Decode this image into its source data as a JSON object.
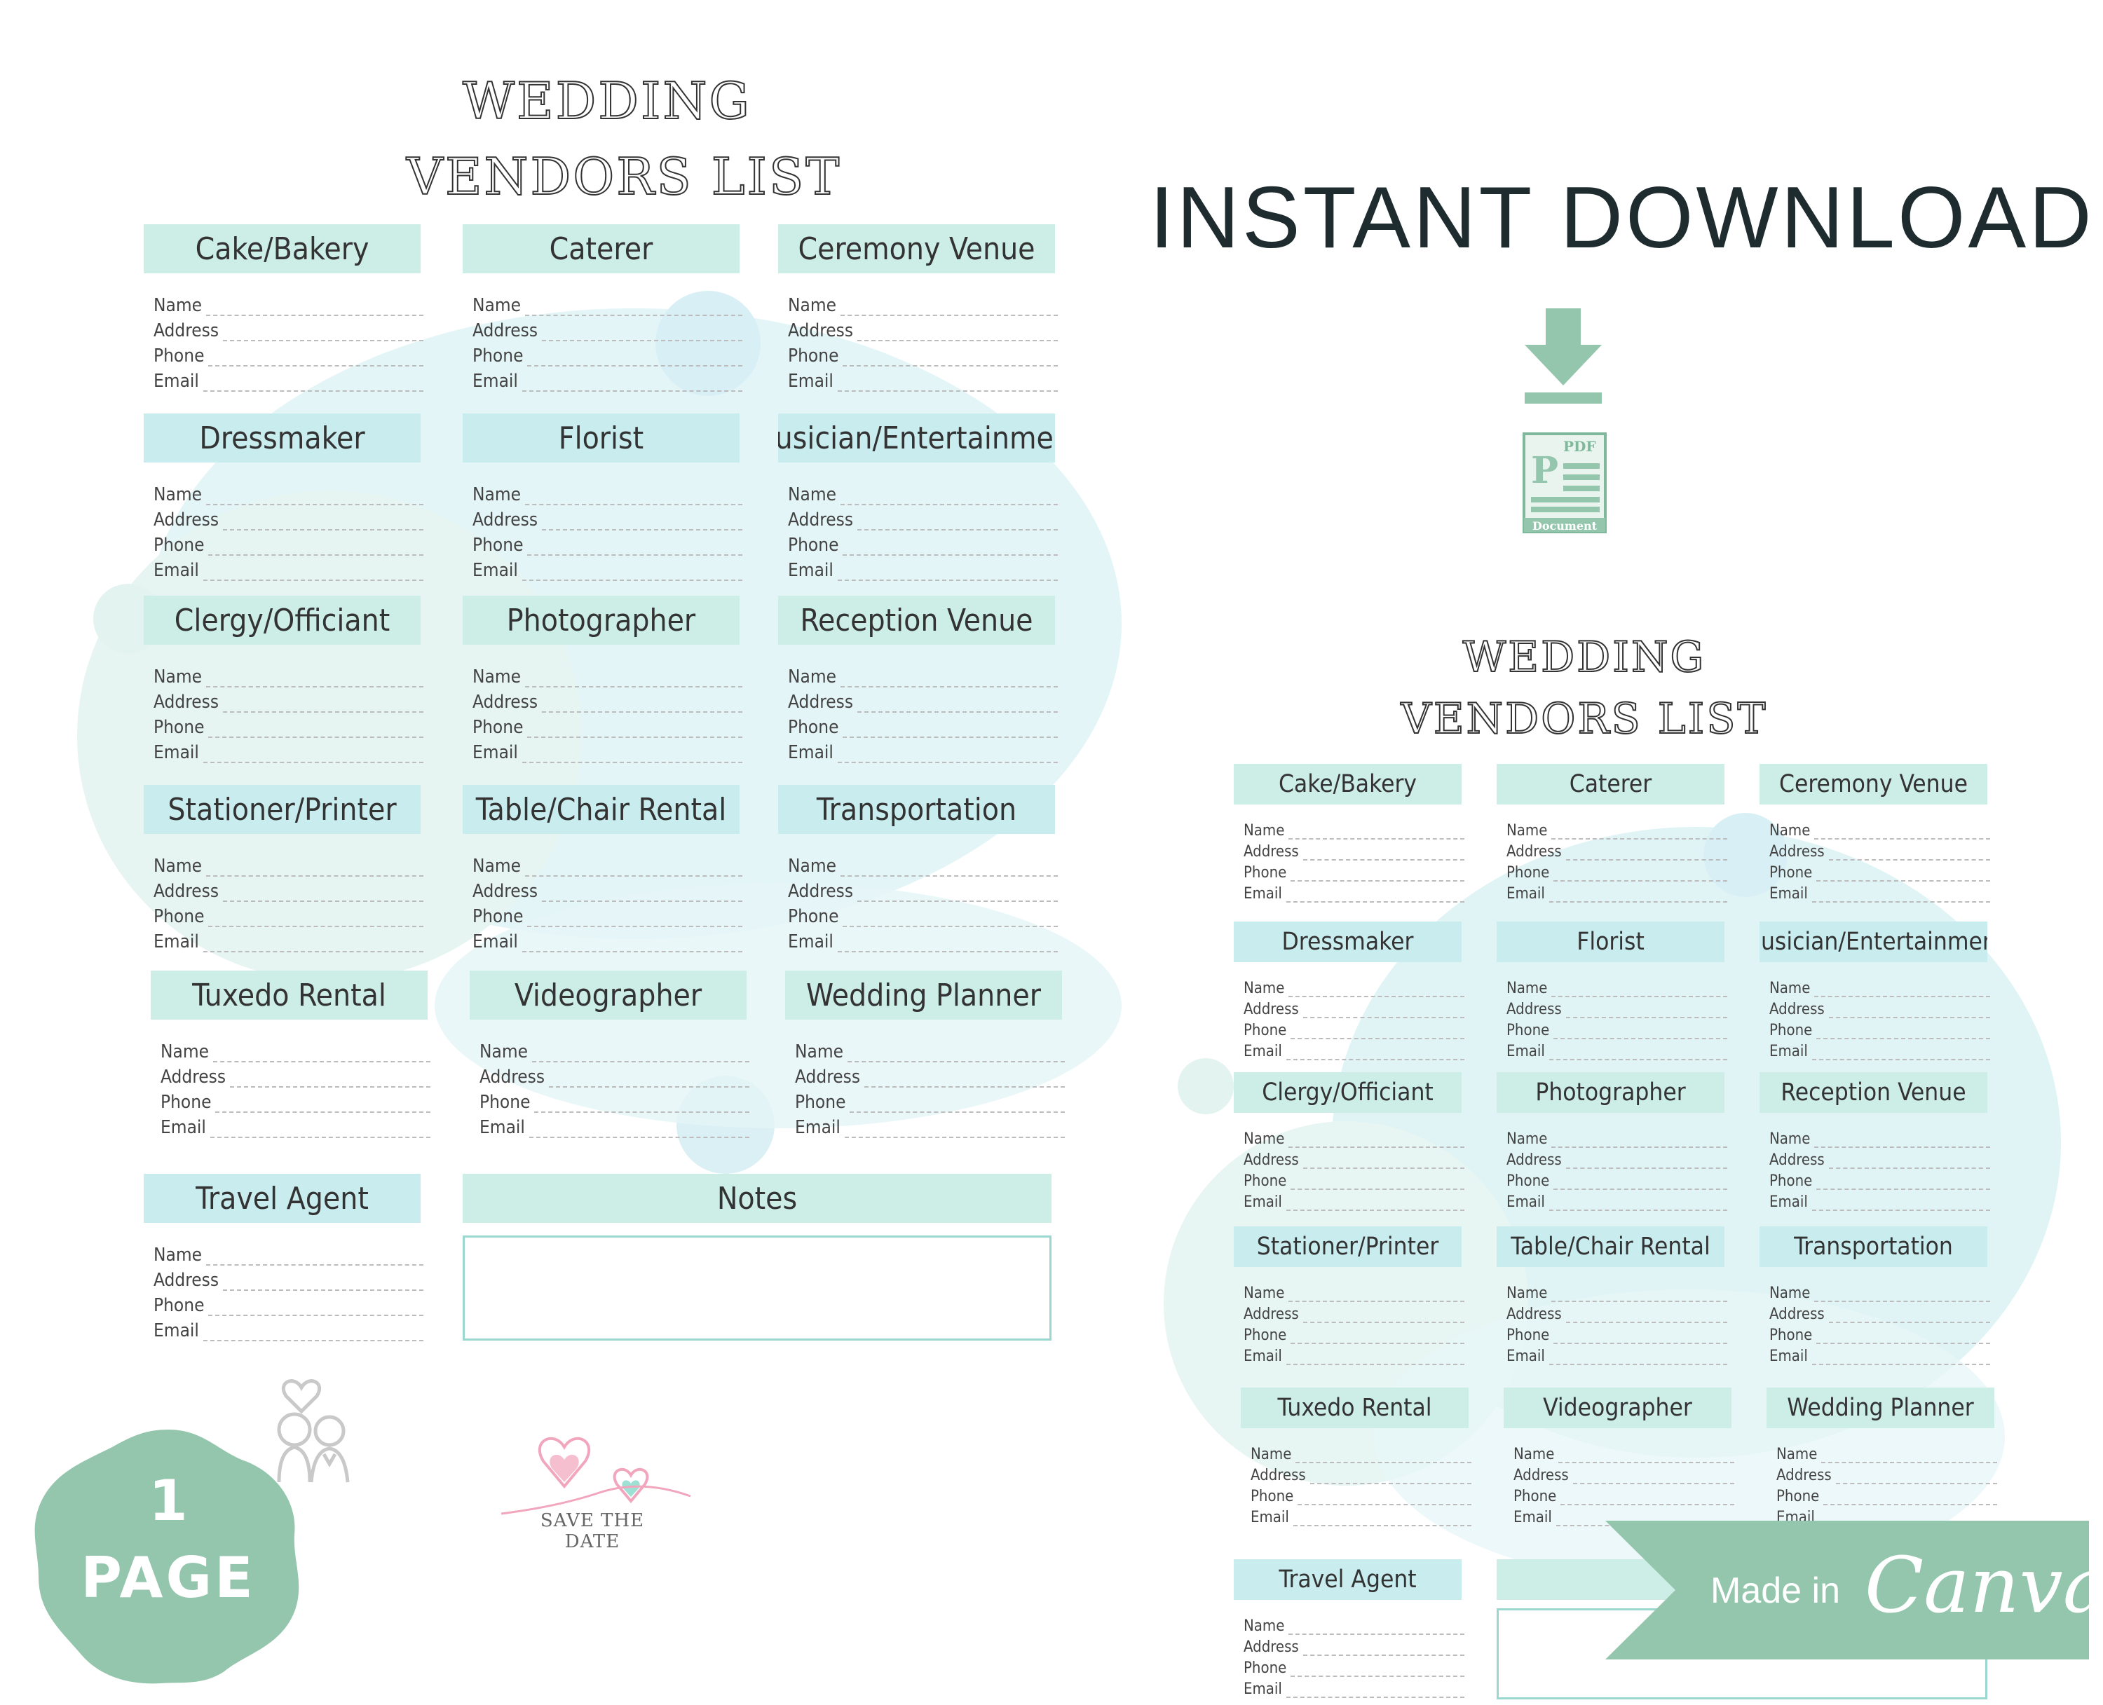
{
  "sheet_title": {
    "line1": "WEDDING",
    "line2": "VENDORS LIST"
  },
  "field_labels": [
    "Name",
    "Address",
    "Phone",
    "Email"
  ],
  "vendors": [
    "Cake/Bakery",
    "Caterer",
    "Ceremony Venue",
    "Dressmaker",
    "Florist",
    "Musician/Entertainment",
    "Clergy/Officiant",
    "Photographer",
    "Reception Venue",
    "Stationer/Printer",
    "Table/Chair Rental",
    "Transportation",
    "Tuxedo Rental",
    "Videographer",
    "Wedding Planner",
    "Travel Agent"
  ],
  "notes_label": "Notes",
  "save_the_date": "SAVE THE DATE",
  "promo": {
    "headline": "INSTANT DOWNLOAD"
  },
  "pdf_icon": {
    "top": "PDF",
    "letter": "P",
    "bottom": "Document"
  },
  "badge": {
    "number": "1",
    "label": "PAGE"
  },
  "canva_badge": {
    "prefix": "Made in",
    "brand": "Canva"
  },
  "colors": {
    "accent": "#cdeee7",
    "mint": "#94c6ad",
    "blob": "#e3f4f7",
    "outline": "#9ad8cf"
  },
  "icons": [
    "download-arrow-icon",
    "pdf-document-icon",
    "couple-icon",
    "hearts-icon"
  ]
}
